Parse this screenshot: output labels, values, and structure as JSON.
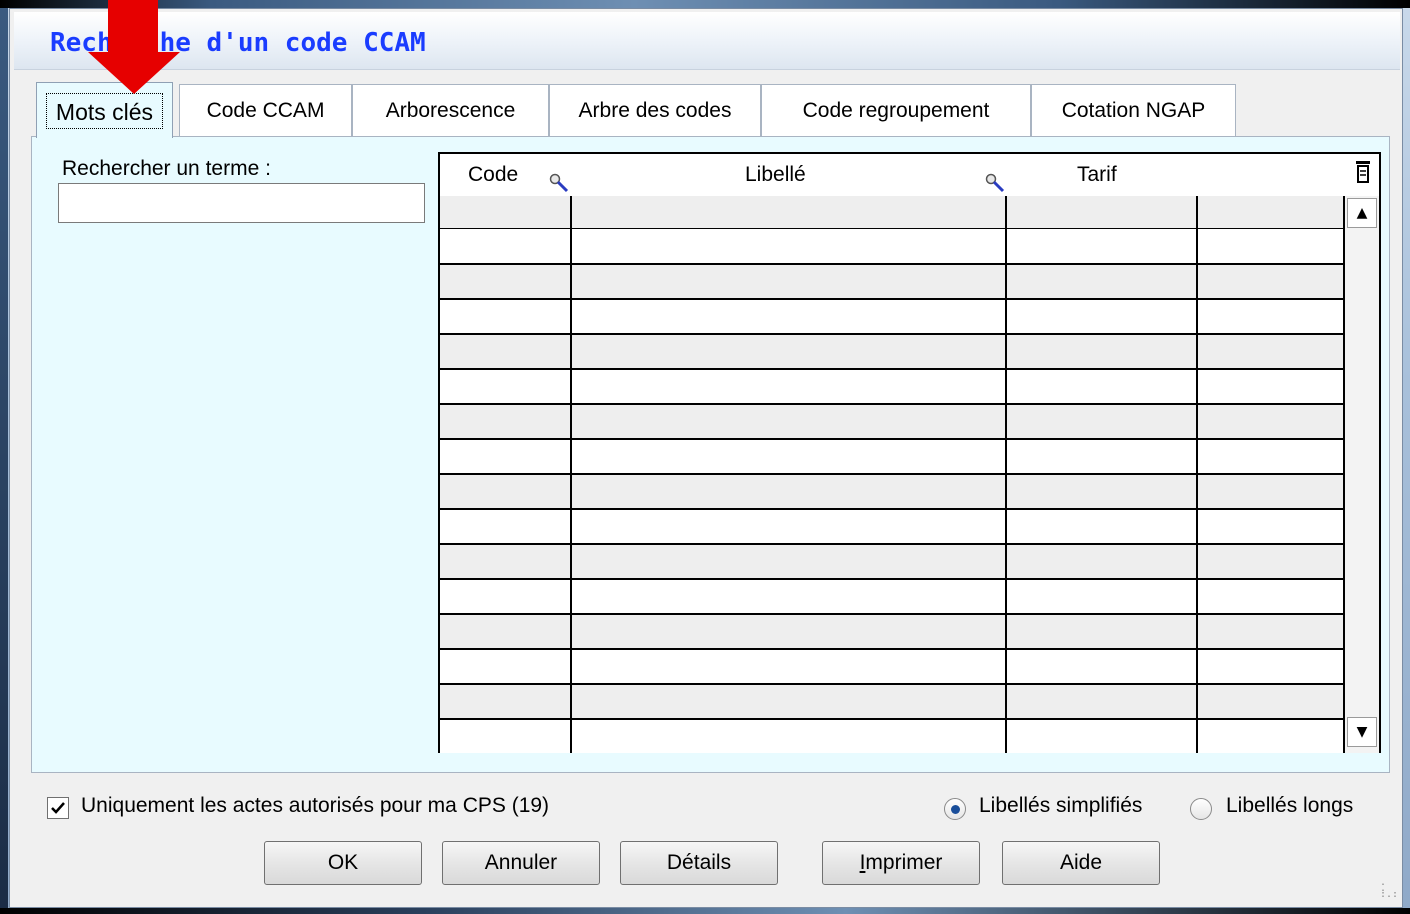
{
  "window": {
    "title": "Recherche d'un code CCAM"
  },
  "tabs": [
    {
      "label": "Mots clés",
      "active": true
    },
    {
      "label": "Code CCAM",
      "active": false
    },
    {
      "label": "Arborescence",
      "active": false
    },
    {
      "label": "Arbre des codes",
      "active": false
    },
    {
      "label": "Code regroupement",
      "active": false
    },
    {
      "label": "Cotation NGAP",
      "active": false
    }
  ],
  "search": {
    "label": "Rechercher un terme :",
    "value": ""
  },
  "table": {
    "columns": [
      "Code",
      "Libellé",
      "Tarif"
    ],
    "rows": [],
    "search_icon": "magnifier-icon",
    "column_chooser_icon": "column-settings-icon",
    "scroll_up_icon": "arrow-up-icon",
    "scroll_down_icon": "arrow-down-icon"
  },
  "options": {
    "authorized_only_label": "Uniquement les actes autorisés pour ma CPS (19)",
    "authorized_only_checked": true,
    "label_mode": [
      {
        "label": "Libellés simplifiés",
        "selected": true
      },
      {
        "label": "Libellés longs",
        "selected": false
      }
    ]
  },
  "buttons": {
    "ok": "OK",
    "cancel": "Annuler",
    "details": "Détails",
    "print": "Imprimer",
    "help": "Aide"
  },
  "annotation": {
    "arrow_color": "#e60000",
    "points_to": "Mots clés"
  },
  "colors": {
    "title_text": "#1a3cff",
    "panel_bg": "#e8fbff",
    "radio_dot": "#1a4e9a"
  }
}
